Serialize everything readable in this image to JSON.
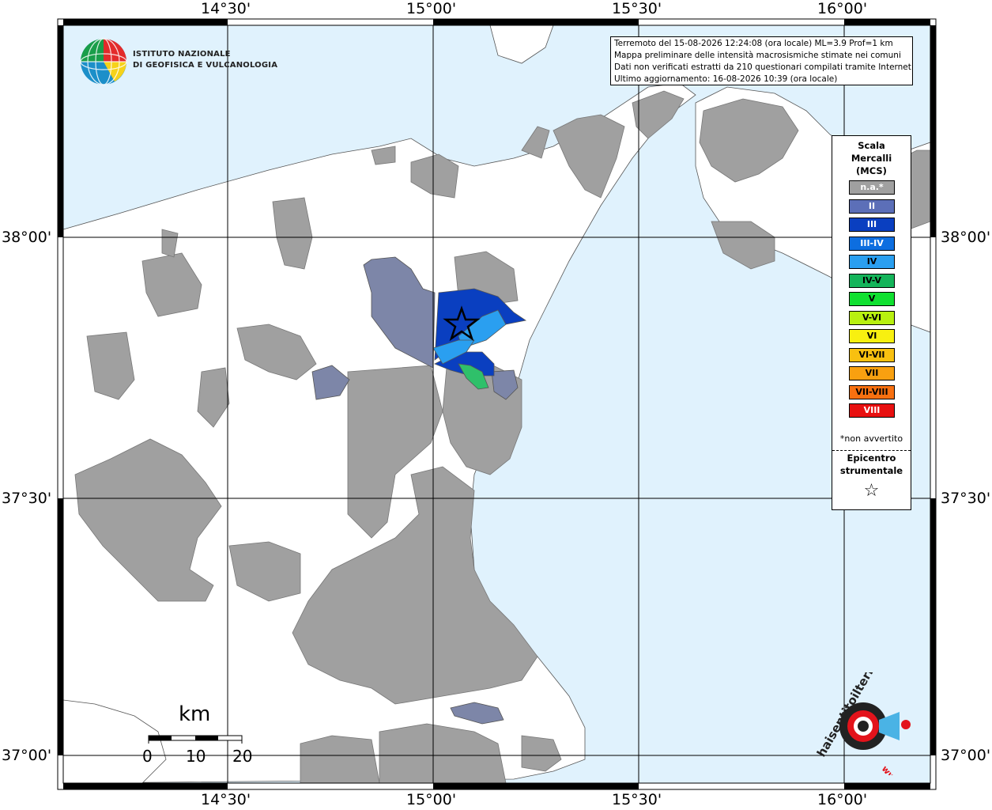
{
  "header": {
    "info_lines": [
      "Terremoto del 15-08-2026 12:24:08 (ora locale) ML=3.9 Prof=1 km",
      "Mappa preliminare delle intensità macrosismiche stimate nei comuni",
      "Dati non verificati estratti da 210 questionari compilati tramite Internet.",
      "Ultimo aggiornamento: 16-08-2026 10:39 (ora locale)"
    ]
  },
  "logo_institute": {
    "line1": "ISTITUTO NAZIONALE",
    "line2": "DI GEOFISICA E VULCANOLOGIA"
  },
  "axes": {
    "longitude_labels": [
      "14°30'",
      "15°00'",
      "15°30'",
      "16°00'"
    ],
    "latitude_labels": [
      "38°00'",
      "37°30'",
      "37°00'"
    ]
  },
  "legend": {
    "title_lines": [
      "Scala",
      "Mercalli",
      "(MCS)"
    ],
    "classes": [
      {
        "label": "n.a.*",
        "color": "#a0a0a0",
        "text_color": "#ffffff"
      },
      {
        "label": "II",
        "color": "#5c6fb8",
        "text_color": "#ffffff"
      },
      {
        "label": "III",
        "color": "#0a3fc0",
        "text_color": "#ffffff"
      },
      {
        "label": "III-IV",
        "color": "#0d6ee0",
        "text_color": "#ffffff"
      },
      {
        "label": "IV",
        "color": "#2a9ff0",
        "text_color": "#000000"
      },
      {
        "label": "IV-V",
        "color": "#14b45a",
        "text_color": "#000000"
      },
      {
        "label": "V",
        "color": "#10e030",
        "text_color": "#000000"
      },
      {
        "label": "V-VI",
        "color": "#b8f010",
        "text_color": "#000000"
      },
      {
        "label": "VI",
        "color": "#f8f010",
        "text_color": "#000000"
      },
      {
        "label": "VI-VII",
        "color": "#f8c010",
        "text_color": "#000000"
      },
      {
        "label": "VII",
        "color": "#f8a010",
        "text_color": "#000000"
      },
      {
        "label": "VII-VIII",
        "color": "#f87010",
        "text_color": "#000000"
      },
      {
        "label": "VIII",
        "color": "#e81010",
        "text_color": "#ffffff"
      }
    ],
    "note": "*non avvertito",
    "epicenter_lines": [
      "Epicentro",
      "strumentale"
    ],
    "epicenter_symbol": "☆"
  },
  "scale_bar": {
    "unit": "km",
    "ticks": [
      "0",
      "10",
      "20"
    ]
  },
  "logo_haisentito": {
    "text": "haisentitoilterremoto.it",
    "url_text": "www."
  },
  "map_colors": {
    "sea": "#e0f2fd",
    "land": "#ffffff",
    "no_data": "#a0a0a0",
    "grid": "#000000"
  },
  "epicenter": {
    "lon": 15.07,
    "lat": 37.78
  }
}
